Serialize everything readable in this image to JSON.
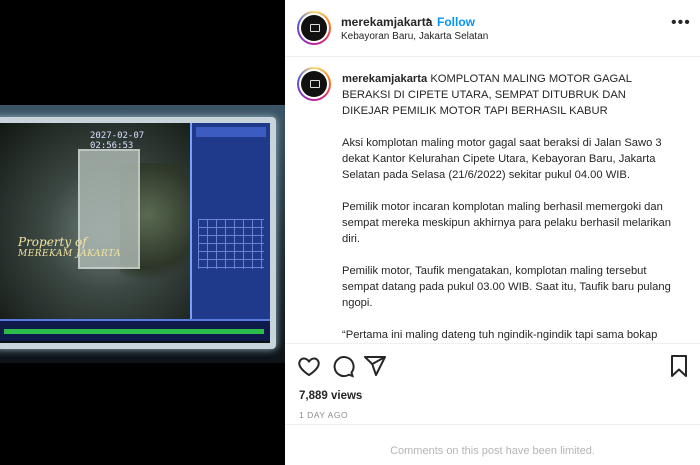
{
  "media": {
    "cam_timestamp": "2027-02-07 02:56:53",
    "watermark_line1": "Property of",
    "watermark_line2": "MEREKAM JAKARTA"
  },
  "post": {
    "username": "merekamjakarta",
    "separator": "•",
    "follow_label": "Follow",
    "location": "Kebayoran Baru, Jakarta Selatan",
    "more_icon": "ellipsis-icon",
    "caption": {
      "username": "merekamjakarta",
      "headline": "KOMPLOTAN MALING MOTOR GAGAL BERAKSI DI CIPETE UTARA, SEMPAT DITUBRUK DAN DIKEJAR PEMILIK MOTOR TAPI BERHASIL KABUR",
      "paragraphs": [
        "Aksi komplotan maling motor gagal saat beraksi di Jalan Sawo 3 dekat Kantor Kelurahan Cipete Utara, Kebayoran Baru, Jakarta Selatan pada Selasa (21/6/2022) sekitar pukul 04.00 WIB.",
        "Pemilik motor incaran komplotan maling berhasil memergoki dan sempat mereka meskipun akhirnya para pelaku berhasil melarikan diri.",
        "Pemilik motor, Taufik mengatakan, komplotan maling tersebut sempat datang pada pukul 03.00 WIB. Saat itu, Taufik baru pulang ngopi.",
        "“Pertama ini maling dateng tuh ngindik-ngindik tapi sama bokap gua digedorlah ceritanya dari pintung samping/gerbang. Kabur"
      ]
    },
    "views": "7,889 views",
    "time_ago": "1 DAY AGO",
    "comments_notice": "Comments on this post have been limited.",
    "colors": {
      "accent": "#0095f6",
      "muted": "#8e8e8e",
      "border": "#efefef"
    }
  }
}
